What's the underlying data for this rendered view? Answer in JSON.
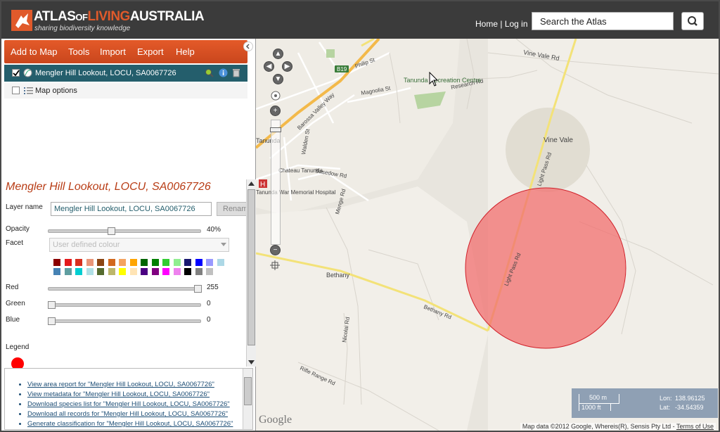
{
  "header": {
    "logo": {
      "part1": "ATLAS",
      "part2": "OF",
      "part3": "LIVING",
      "part4": "AUSTRALIA",
      "tagline": "sharing biodiversity knowledge"
    },
    "links": {
      "home": "Home",
      "sep": "|",
      "login": "Log in"
    },
    "search": {
      "placeholder": "Search the Atlas"
    }
  },
  "menu": {
    "items": [
      "Add to Map",
      "Tools",
      "Import",
      "Export",
      "Help"
    ]
  },
  "layers": {
    "active": {
      "label": "Mengler Hill Lookout, LOCU, SA0067726",
      "checked": true
    },
    "map_options": {
      "label": "Map options",
      "checked": false
    }
  },
  "detail": {
    "title": "Mengler Hill Lookout, LOCU, SA0067726",
    "layer_name_label": "Layer name",
    "layer_name_value": "Mengler Hill Lookout, LOCU, SA0067726",
    "rename_label": "Rename",
    "opacity_label": "Opacity",
    "opacity_value": "40%",
    "opacity_fraction": 0.4,
    "facet_label": "Facet",
    "facet_placeholder": "User defined colour",
    "red_label": "Red",
    "red_value": "255",
    "green_label": "Green",
    "green_value": "0",
    "blue_label": "Blue",
    "blue_value": "0",
    "legend_label": "Legend",
    "legend_color": "#ff0000",
    "swatches_row1": [
      "#8b0000",
      "#e31a1c",
      "#d7301f",
      "#e9967a",
      "#8b4513",
      "#d2691e",
      "#f4a460",
      "#ffa500",
      "#006400",
      "#008000",
      "#32cd32",
      "#90ee90",
      "#191970",
      "#0000ff",
      "#9999ff",
      "#add8e6"
    ],
    "swatches_row2": [
      "#4682b4",
      "#5f9ea0",
      "#00ced1",
      "#b0e0e6",
      "#556b2f",
      "#bdb76b",
      "#ffff00",
      "#ffe4b5",
      "#4b0082",
      "#800080",
      "#ff00ff",
      "#ee82ee",
      "#000000",
      "#808080",
      "#c0c0c0"
    ]
  },
  "links": [
    "View area report for \"Mengler Hill Lookout, LOCU, SA0067726\"",
    "View metadata for \"Mengler Hill Lookout, LOCU, SA0067726\"",
    "Download species list for \"Mengler Hill Lookout, LOCU, SA0067726\"",
    "Download all records for \"Mengler Hill Lookout, LOCU, SA0067726\"",
    "Generate classification for \"Mengler Hill Lookout, LOCU, SA0067726\""
  ],
  "map": {
    "labels": {
      "vine_vale_rd": "Vine Vale Rd",
      "philip_st": "Philip St",
      "b19": "B19",
      "research_rd": "Research Rd",
      "tanunda_rec": "Tanunda Recreation Centre",
      "magnolia_st": "Magnolia St",
      "barossa_valley_way": "Barossa Valley Way",
      "vine_vale": "Vine Vale",
      "light_pass_rd_north": "Light Pass Rd",
      "tanunda": "Tanunda",
      "chateau_tanunda": "Chateau Tanunda",
      "basedow_rd": "Basedow Rd",
      "walden_st": "Walden St",
      "menge_rd": "Menge Rd",
      "hospital": "Tanunda War Memorial Hospital",
      "bethany": "Bethany",
      "bethany_rd": "Bethany Rd",
      "light_pass_rd": "Light Pass Rd",
      "nicolai_rd": "Nicolai Rd",
      "rifle_range_rd": "Rifle Range Rd"
    },
    "area_color": "#f26f6f",
    "scale": {
      "metres": "500 m",
      "feet": "1000 ft"
    },
    "coords": {
      "lon_label": "Lon:",
      "lon": "138.96125",
      "lat_label": "Lat:",
      "lat": "-34.54359"
    },
    "google": "Google",
    "attribution": "Map data ©2012 Google, Whereis(R), Sensis Pty Ltd -",
    "terms": "Terms of Use"
  }
}
